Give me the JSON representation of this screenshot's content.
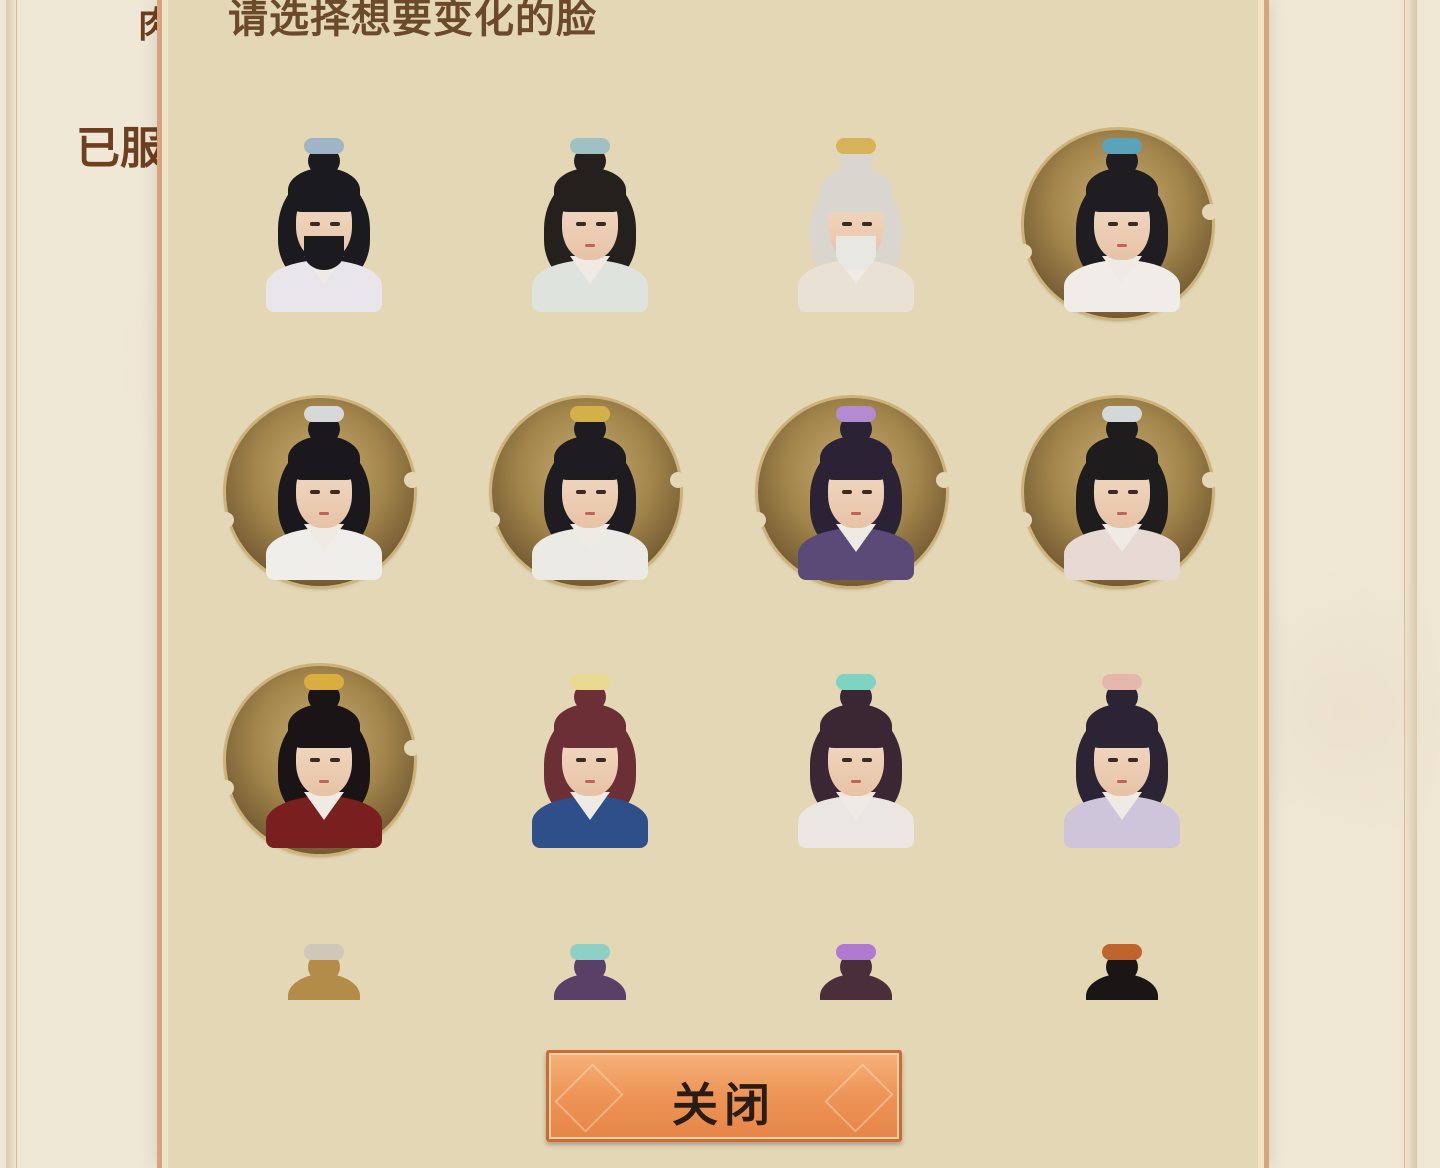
{
  "background": {
    "text_1": "肉",
    "text_2": "已服"
  },
  "modal": {
    "title": "请选择想要变化的脸",
    "close_label": "关闭"
  },
  "faces": [
    {
      "id": "face-1",
      "style": "plain",
      "hair": "#1b1a1f",
      "robe": "#e8e6ea",
      "beard": "#1b1a1f",
      "orn": "#9fb5c7"
    },
    {
      "id": "face-2",
      "style": "plain",
      "hair": "#24201e",
      "robe": "#dfe3de",
      "beard": "",
      "orn": "#9fc1c4"
    },
    {
      "id": "face-3",
      "style": "plain",
      "hair": "#d9d6d0",
      "robe": "#e9e2d4",
      "beard": "#e9e7e2",
      "orn": "#d8b35a"
    },
    {
      "id": "face-4",
      "style": "medallion",
      "hair": "#1f1c22",
      "robe": "#f0ece8",
      "beard": "",
      "orn": "#5aa3b8"
    },
    {
      "id": "face-5",
      "style": "medallion",
      "hair": "#1a181c",
      "robe": "#f0eeea",
      "beard": "",
      "orn": "#d6d8da"
    },
    {
      "id": "face-6",
      "style": "medallion",
      "hair": "#1e1c20",
      "robe": "#eceae4",
      "beard": "",
      "orn": "#d4b04a"
    },
    {
      "id": "face-7",
      "style": "medallion",
      "hair": "#2c2236",
      "robe": "#5b4a78",
      "beard": "",
      "orn": "#b48ad0"
    },
    {
      "id": "face-8",
      "style": "medallion",
      "hair": "#1f1c1e",
      "robe": "#e7d9d4",
      "beard": "",
      "orn": "#d3d8d8"
    },
    {
      "id": "face-9",
      "style": "medallion",
      "hair": "#1b1416",
      "robe": "#7a1f1f",
      "beard": "",
      "orn": "#d9ad3e"
    },
    {
      "id": "face-10",
      "style": "plain",
      "hair": "#6d2f36",
      "robe": "#2f4f8a",
      "beard": "",
      "orn": "#e8d890"
    },
    {
      "id": "face-11",
      "style": "plain",
      "hair": "#3b2733",
      "robe": "#ece6e2",
      "beard": "",
      "orn": "#7fd3c3"
    },
    {
      "id": "face-12",
      "style": "plain",
      "hair": "#2a2434",
      "robe": "#cfc5da",
      "beard": "",
      "orn": "#e5b6ab"
    },
    {
      "id": "face-13",
      "style": "plain",
      "hair": "#b48c4a",
      "robe": "#e8e4dc",
      "beard": "",
      "orn": "#cfc7b8"
    },
    {
      "id": "face-14",
      "style": "plain",
      "hair": "#5a3f66",
      "robe": "#e8e4dc",
      "beard": "",
      "orn": "#8fd0c6"
    },
    {
      "id": "face-15",
      "style": "plain",
      "hair": "#4a2f3a",
      "robe": "#e8e4dc",
      "beard": "",
      "orn": "#b07ad0"
    },
    {
      "id": "face-16",
      "style": "plain",
      "hair": "#1a1616",
      "robe": "#e8e4dc",
      "beard": "",
      "orn": "#c0642e"
    }
  ]
}
